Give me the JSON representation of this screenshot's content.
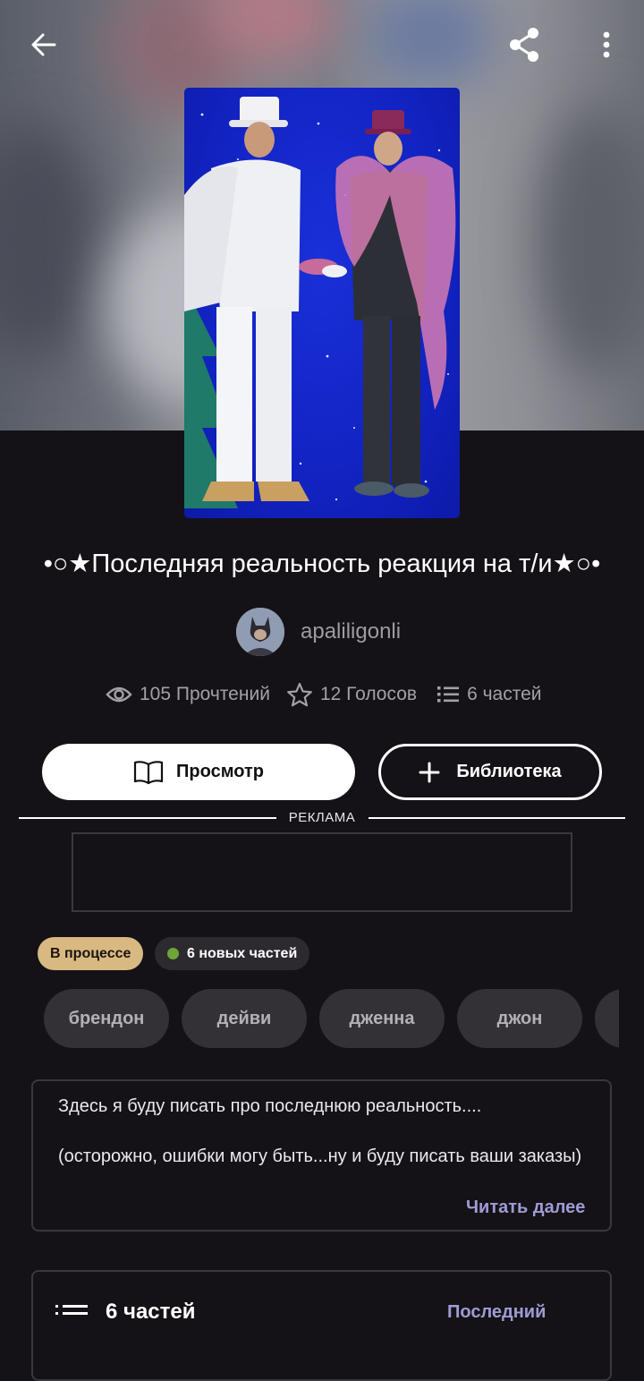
{
  "header": {
    "back_icon": "arrow-left-icon",
    "share_icon": "share-icon",
    "more_icon": "more-vertical-icon"
  },
  "story": {
    "title": "•○★Последняя реальность реакция на т/и★○•",
    "author": "apaliligonli",
    "stats": {
      "reads": "105 Прочтений",
      "votes": "12 Голосов",
      "parts": "6 частей"
    }
  },
  "actions": {
    "view_label": "Просмотр",
    "library_label": "Библиотека"
  },
  "ad": {
    "label": "РЕКЛАМА"
  },
  "status": {
    "state": "В процессе",
    "new_parts": "6 новых частей",
    "state_color": "#d8b982",
    "new_dot_color": "#6fa536"
  },
  "tags": [
    "брендон",
    "дейви",
    "дженна",
    "джон"
  ],
  "description": {
    "line1": "Здесь я буду писать про последнюю реальность....",
    "line2": "(осторожно, ошибки могу быть...ну и буду писать ваши заказы)",
    "read_more": "Читать далее"
  },
  "parts_section": {
    "title": "6 частей",
    "link": "Последний"
  },
  "colors": {
    "background": "#141216",
    "accent": "#a09bd6"
  }
}
